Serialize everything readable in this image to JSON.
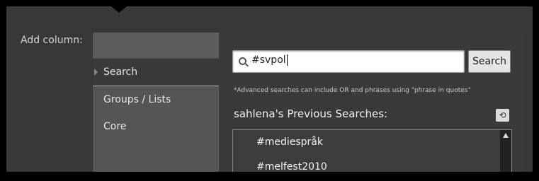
{
  "header": {
    "add_column_label": "Add column:"
  },
  "sidebar": {
    "items": [
      {
        "label": "Search",
        "active": true
      },
      {
        "label": "Groups / Lists",
        "active": false
      },
      {
        "label": "Core",
        "active": false
      }
    ]
  },
  "search": {
    "value": "#svpol",
    "button_label": "Search",
    "hint": "*Advanced searches can include OR and phrases using \"phrase in quotes\""
  },
  "previous": {
    "title": "sahlena's Previous Searches:",
    "refresh_icon": "refresh-icon",
    "items": [
      "#mediespråk",
      "#melfest2010"
    ]
  }
}
